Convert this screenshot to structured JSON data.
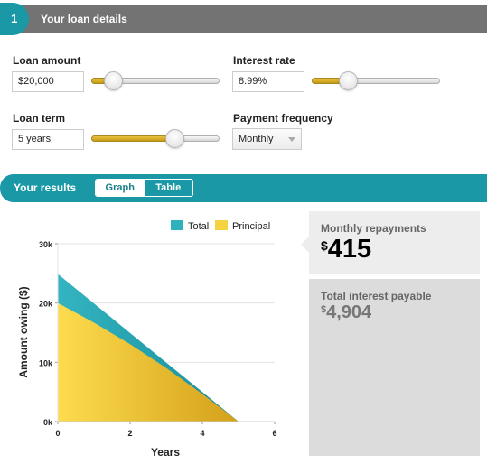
{
  "step": {
    "number": "1",
    "title": "Your loan details"
  },
  "fields": {
    "loan_amount": {
      "label": "Loan amount",
      "value": "$20,000",
      "slider_fraction": 0.17
    },
    "interest_rate": {
      "label": "Interest rate",
      "value": "8.99%",
      "slider_fraction": 0.28
    },
    "loan_term": {
      "label": "Loan term",
      "value": "5 years",
      "slider_fraction": 0.65
    },
    "payment_frequency": {
      "label": "Payment frequency",
      "value": "Monthly"
    }
  },
  "results": {
    "title": "Your results",
    "tabs": [
      {
        "label": "Graph",
        "active": true
      },
      {
        "label": "Table",
        "active": false
      }
    ],
    "monthly": {
      "label": "Monthly repayments",
      "currency": "$",
      "amount": "415"
    },
    "interest": {
      "label": "Total interest payable",
      "currency": "$",
      "amount": "4,904"
    }
  },
  "colors": {
    "teal": "#1b98a5",
    "gold": "#f0c93a",
    "grey_bar": "#737373"
  },
  "chart_data": {
    "type": "area",
    "title": "",
    "xlabel": "Years",
    "ylabel": "Amount owing ($)",
    "xlim": [
      0,
      6
    ],
    "ylim": [
      0,
      30000
    ],
    "xticks": [
      "0",
      "2",
      "4",
      "6"
    ],
    "yticks": [
      "0k",
      "10k",
      "20k",
      "30k"
    ],
    "grid": true,
    "legend_position": "top-right",
    "series": [
      {
        "name": "Total",
        "color": "#2fb0bd",
        "x": [
          0,
          1,
          2,
          3,
          4,
          5
        ],
        "values": [
          24904,
          19923,
          14942,
          9962,
          4981,
          0
        ]
      },
      {
        "name": "Principal",
        "color": "#f5d23f",
        "x": [
          0,
          1,
          2,
          3,
          4,
          5
        ],
        "values": [
          20000,
          16700,
          13050,
          9050,
          4650,
          0
        ]
      }
    ]
  }
}
